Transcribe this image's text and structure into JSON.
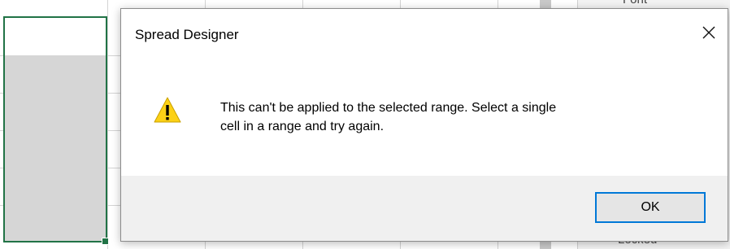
{
  "background": {
    "panel_top_label": "Font",
    "panel_bottom_label": "Locked",
    "selection_color": "#217346"
  },
  "dialog": {
    "title": "Spread Designer",
    "close_icon": "close-icon",
    "icon": "warning-icon",
    "message_line1": "This can't be applied to the selected range. Select a single",
    "message_line2": "cell in a range and try again.",
    "ok_label": "OK",
    "accent_color": "#0078d7",
    "warning_color": "#fcd116"
  }
}
